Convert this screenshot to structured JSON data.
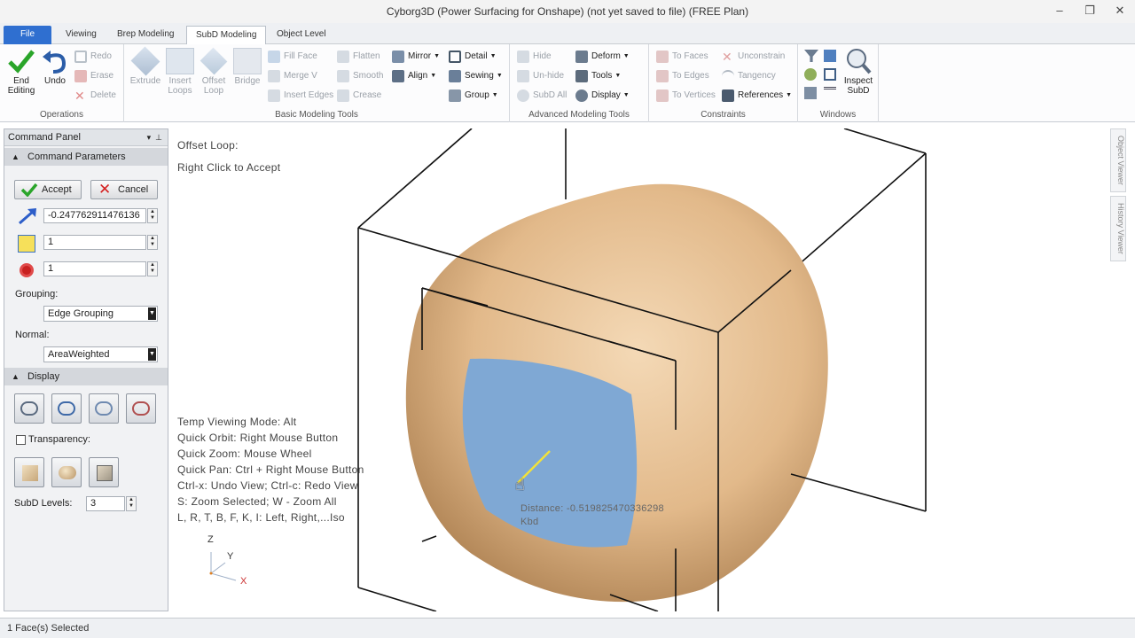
{
  "title": "Cyborg3D (Power Surfacing for Onshape)  (not yet saved to file)  (FREE Plan)",
  "tabs": [
    "File",
    "Viewing",
    "Brep Modeling",
    "SubD Modeling",
    "Object Level"
  ],
  "ribbon": {
    "operations": {
      "end_editing": "End Editing",
      "undo": "Undo",
      "redo": "Redo",
      "erase": "Erase",
      "delete": "Delete",
      "label": "Operations"
    },
    "basic": {
      "extrude": "Extrude",
      "insert_loops": "Insert Loops",
      "offset_loop": "Offset Loop",
      "bridge": "Bridge",
      "fill_face": "Fill Face",
      "merge_v": "Merge V",
      "insert_edges": "Insert Edges",
      "flatten": "Flatten",
      "smooth": "Smooth",
      "crease": "Crease",
      "mirror": "Mirror",
      "align": "Align",
      "detail": "Detail",
      "sewing": "Sewing",
      "group": "Group",
      "label": "Basic Modeling Tools"
    },
    "advanced": {
      "hide": "Hide",
      "unhide": "Un-hide",
      "subd_all": "SubD All",
      "deform": "Deform",
      "tools": "Tools",
      "display": "Display",
      "label": "Advanced Modeling Tools"
    },
    "constraints": {
      "to_faces": "To Faces",
      "to_edges": "To Edges",
      "to_vertices": "To Vertices",
      "unconstrain": "Unconstrain",
      "tangency": "Tangency",
      "references": "References",
      "label": "Constraints"
    },
    "windows": {
      "inspect_subd": "Inspect SubD",
      "label": "Windows"
    }
  },
  "panel": {
    "title": "Command Panel",
    "params_section": "Command Parameters",
    "accept": "Accept",
    "cancel": "Cancel",
    "distance_value": "-0.247762911476136",
    "loops_value": "1",
    "count_value": "1",
    "grouping_label": "Grouping:",
    "grouping_value": "Edge Grouping",
    "normal_label": "Normal:",
    "normal_value": "AreaWeighted",
    "display_section": "Display",
    "transparency_label": "Transparency:",
    "subd_levels_label": "SubD Levels:",
    "subd_levels_value": "3"
  },
  "viewport": {
    "cmd_title": "Offset Loop:",
    "cmd_hint": "Right Click to Accept",
    "help_lines": [
      "Temp Viewing Mode: Alt",
      "Quick Orbit: Right Mouse Button",
      "Quick Zoom: Mouse Wheel",
      "Quick Pan: Ctrl + Right Mouse Button",
      "Ctrl-x: Undo View; Ctrl-c: Redo View",
      "S: Zoom Selected; W - Zoom All",
      "L, R, T, B, F, K, I: Left, Right,...Iso"
    ],
    "distance_readout": "Distance: -0.519825470336298",
    "kbd": "Kbd",
    "axis_z": "Z",
    "axis_y": "Y",
    "axis_x": "X"
  },
  "side_tabs": [
    "Object Viewer",
    "History Viewer"
  ],
  "status": "1 Face(s) Selected",
  "colors": {
    "accent": "#2f6fd0",
    "body": "#e6bf93",
    "face": "#7fa8d4"
  }
}
